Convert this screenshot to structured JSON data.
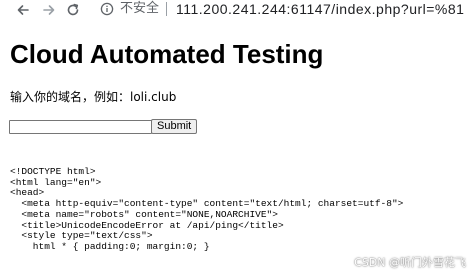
{
  "browser": {
    "security_label": "不安全",
    "url": "111.200.241.244:61147/index.php?url=%81"
  },
  "page": {
    "title": "Cloud Automated Testing",
    "prompt": "输入你的域名，例如：loli.club",
    "input_value": "",
    "submit_label": "Submit",
    "code_lines": [
      "<!DOCTYPE html>",
      "<html lang=\"en\">",
      "<head>",
      "  <meta http-equiv=\"content-type\" content=\"text/html; charset=utf-8\">",
      "  <meta name=\"robots\" content=\"NONE,NOARCHIVE\">",
      "  <title>UnicodeEncodeError at /api/ping</title>",
      "  <style type=\"text/css\">",
      "    html * { padding:0; margin:0; }"
    ]
  },
  "watermark": "CSDN @听门外雪花飞",
  "icons": {
    "back": "arrow-left-icon",
    "forward": "arrow-right-icon",
    "reload": "reload-icon",
    "security": "info-icon"
  }
}
